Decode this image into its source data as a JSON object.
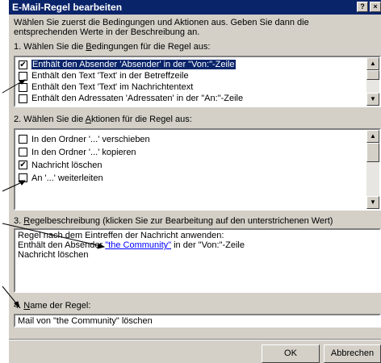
{
  "dialog": {
    "title": "E-Mail-Regel bearbeiten",
    "help_button": "?",
    "close_button": "×",
    "intro_line1": "Wählen Sie zuerst die Bedingungen und Aktionen aus. Geben Sie dann die",
    "intro_line2": "entsprechenden Werte in der Beschreibung an."
  },
  "conditions": {
    "heading_pre": "1. Wählen Sie die ",
    "heading_key": "B",
    "heading_post": "edingungen für die Regel aus:",
    "items": [
      {
        "label": "Enthält den Absender 'Absender' in der \"Von:\"-Zeile",
        "checked": true,
        "selected": true
      },
      {
        "label": "Enthält den Text 'Text' in der Betreffzeile",
        "checked": false,
        "selected": false
      },
      {
        "label": "Enthält den Text 'Text' im Nachrichtentext",
        "checked": false,
        "selected": false
      },
      {
        "label": "Enthält den Adressaten 'Adressaten' in der \"An:\"-Zeile",
        "checked": false,
        "selected": false
      }
    ]
  },
  "actions": {
    "heading_pre": "2. Wählen Sie die ",
    "heading_key": "A",
    "heading_post": "ktionen für die Regel aus:",
    "items": [
      {
        "label": "In den Ordner '...' verschieben",
        "checked": false
      },
      {
        "label": "In den Ordner '...' kopieren",
        "checked": false
      },
      {
        "label": "Nachricht löschen",
        "checked": true
      },
      {
        "label": "An '...' weiterleiten",
        "checked": false
      }
    ]
  },
  "description": {
    "heading_num": "3. ",
    "heading_key": "R",
    "heading_post": "egelbeschreibung (klicken Sie zur Bearbeitung auf den unterstrichenen Wert)",
    "line1": "Regel nach dem Eintreffen der Nachricht anwenden:",
    "line2_pre": "Enthält den Absender ",
    "line2_link": "\"the Community\"",
    "line2_post": " in der \"Von:\"-Zeile",
    "line3": "Nachricht löschen"
  },
  "rule_name": {
    "heading_num": "4. ",
    "heading_key": "N",
    "heading_post": "ame der Regel:",
    "value": "Mail von \"the Community\" löschen"
  },
  "buttons": {
    "ok": "OK",
    "cancel": "Abbrechen"
  },
  "icons": {
    "check": "✔",
    "scroll_up": "▲",
    "scroll_down": "▼"
  }
}
